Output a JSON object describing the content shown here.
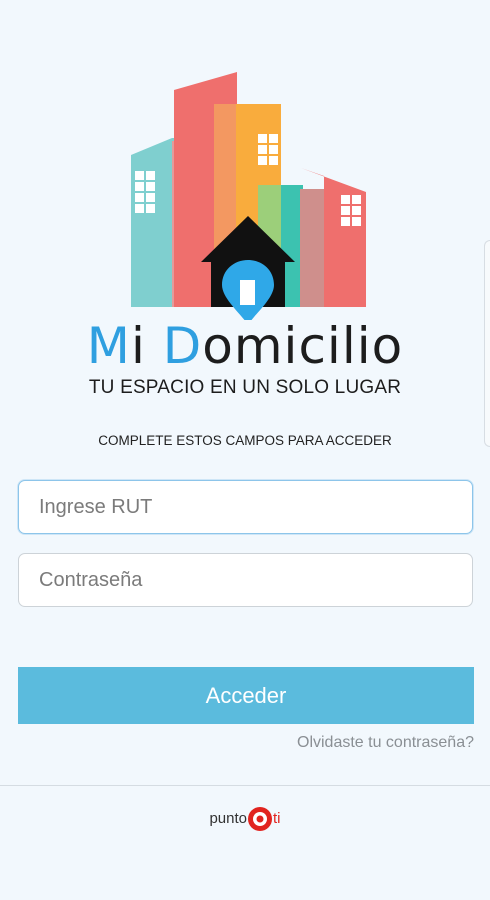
{
  "brand": {
    "name_first_letter_1": "M",
    "name_rest_1": "i ",
    "name_first_letter_2": "D",
    "name_rest_2": "omicilio",
    "tagline": "TU ESPACIO EN UN SOLO LUGAR"
  },
  "form": {
    "instructions": "COMPLETE ESTOS CAMPOS PARA ACCEDER",
    "rut_placeholder": "Ingrese RUT",
    "password_placeholder": "Contraseña",
    "submit_label": "Acceder",
    "forgot_label": "Olvidaste tu contraseña?"
  },
  "footer": {
    "logo_left": "punto",
    "logo_right": "ti"
  },
  "colors": {
    "accent_blue": "#2f9fe0",
    "button": "#5bbbdd",
    "footer_red": "#e1241f"
  }
}
